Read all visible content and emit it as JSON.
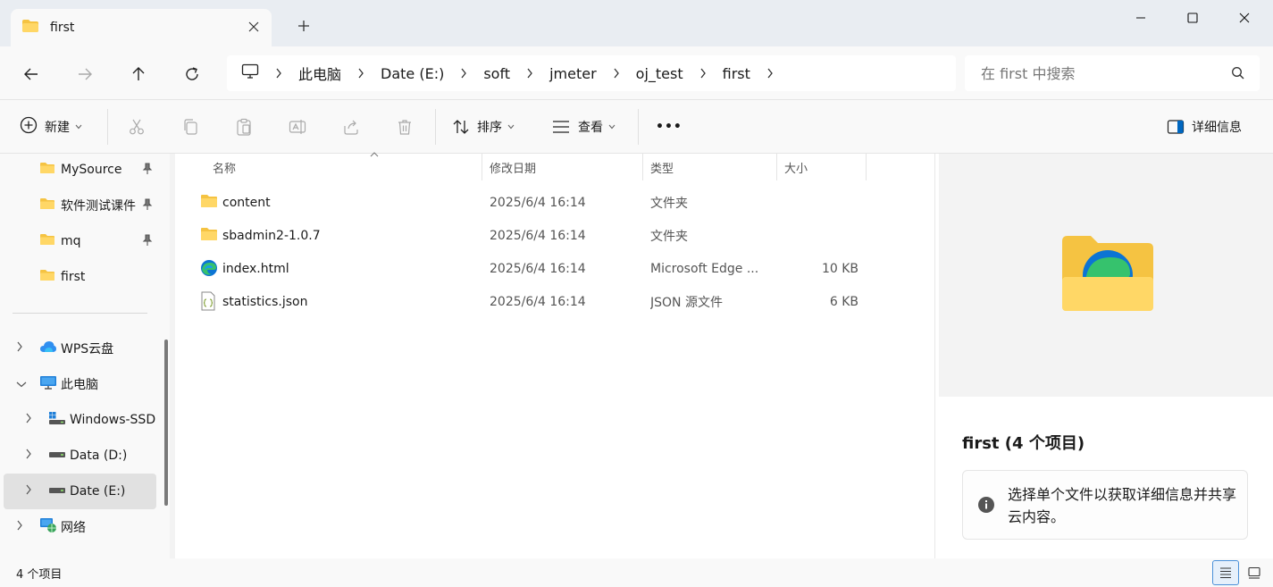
{
  "tab": {
    "title": "first",
    "close_icon": "close-icon",
    "new_tab_icon": "plus-icon"
  },
  "window": {
    "minimize_icon": "minimize-icon",
    "maximize_icon": "maximize-icon",
    "close_icon": "close-icon"
  },
  "nav": {
    "back_icon": "arrow-left-icon",
    "forward_icon": "arrow-right-icon",
    "up_icon": "arrow-up-icon",
    "refresh_icon": "refresh-icon"
  },
  "breadcrumb": {
    "root_icon": "monitor-icon",
    "items": [
      "此电脑",
      "Date (E:)",
      "soft",
      "jmeter",
      "oj_test",
      "first"
    ]
  },
  "search": {
    "placeholder": "在 first 中搜索"
  },
  "toolbar": {
    "new_label": "新建",
    "sort_label": "排序",
    "view_label": "查看",
    "more_label": "•••",
    "details_label": "详细信息"
  },
  "sidebar": {
    "quick": [
      {
        "label": "MySource",
        "pinned": true
      },
      {
        "label": "软件测试课件",
        "pinned": true
      },
      {
        "label": "mq",
        "pinned": true
      },
      {
        "label": "first",
        "pinned": false
      }
    ],
    "tree": [
      {
        "label": "WPS云盘",
        "icon": "cloud-icon",
        "expanded": false
      },
      {
        "label": "此电脑",
        "icon": "monitor-icon",
        "expanded": true
      },
      {
        "label": "Windows-SSD",
        "icon": "drive-windows-icon",
        "expanded": false
      },
      {
        "label": "Data (D:)",
        "icon": "drive-icon",
        "expanded": false
      },
      {
        "label": "Date (E:)",
        "icon": "drive-icon",
        "expanded": false,
        "selected": true
      },
      {
        "label": "网络",
        "icon": "network-icon",
        "expanded": false
      }
    ]
  },
  "columns": {
    "name": "名称",
    "date": "修改日期",
    "type": "类型",
    "size": "大小"
  },
  "files": [
    {
      "name": "content",
      "date": "2025/6/4 16:14",
      "type": "文件夹",
      "size": "",
      "icon": "folder-icon"
    },
    {
      "name": "sbadmin2-1.0.7",
      "date": "2025/6/4 16:14",
      "type": "文件夹",
      "size": "",
      "icon": "folder-icon"
    },
    {
      "name": "index.html",
      "date": "2025/6/4 16:14",
      "type": "Microsoft Edge ...",
      "size": "10 KB",
      "icon": "edge-icon"
    },
    {
      "name": "statistics.json",
      "date": "2025/6/4 16:14",
      "type": "JSON 源文件",
      "size": "6 KB",
      "icon": "json-file-icon"
    }
  ],
  "details": {
    "title": "first (4 个项目)",
    "info": "选择单个文件以获取详细信息并共享云内容。"
  },
  "status": {
    "count": "4 个项目"
  },
  "colors": {
    "folder": "#f5c342",
    "accent": "#0067c0",
    "selected": "#e1e1e1"
  }
}
